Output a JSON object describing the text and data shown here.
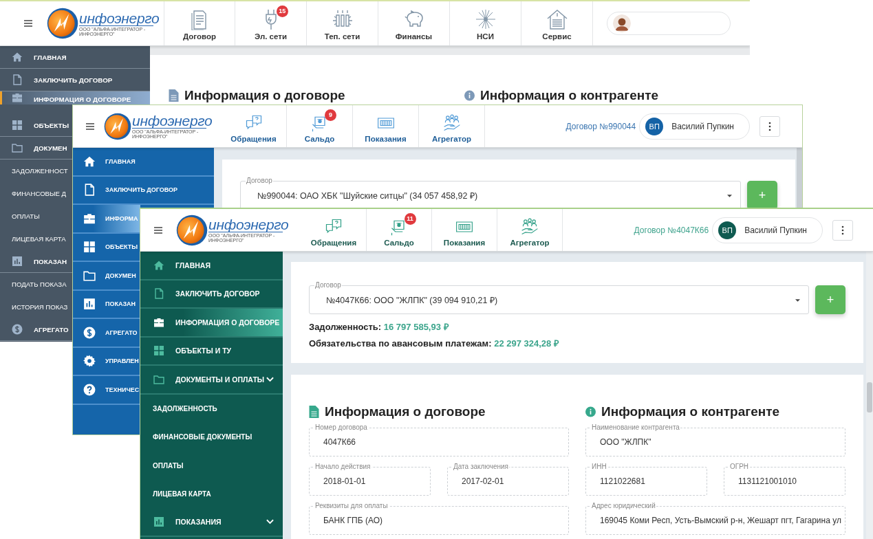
{
  "windows": [
    {
      "kind": "legacy",
      "brand": {
        "name": "инфоэнерго",
        "tagline": "ООО \"АЛЬФА-ИНТЕГРАТОР - ИНФОЭНЕРГО\""
      },
      "nav": [
        {
          "kind": "contract",
          "label": "Договор"
        },
        {
          "kind": "power",
          "label": "Эл. сети",
          "badge": "15"
        },
        {
          "kind": "heat",
          "label": "Теп. сети"
        },
        {
          "kind": "finance",
          "label": "Финансы"
        },
        {
          "kind": "nsi",
          "label": "НСИ"
        },
        {
          "kind": "service",
          "label": "Сервис"
        }
      ],
      "user": {
        "kind": "photo"
      },
      "sidebar": [
        {
          "kind": "home",
          "label": "ГЛАВНАЯ",
          "selected": false
        },
        {
          "kind": "file",
          "label": "ЗАКЛЮЧИТЬ ДОГОВОР",
          "selected": false
        },
        {
          "kind": "briefcase",
          "label": "ИНФОРМАЦИЯ О ДОГОВОРЕ",
          "selected": true
        },
        {
          "kind": "grid",
          "label": "ОБЪЕКТЫ",
          "selected": false
        },
        {
          "kind": "folder",
          "label": "ДОКУМЕН",
          "selected": false
        },
        {
          "kind": "sub",
          "label": "ЗАДОЛЖЕННОСТ",
          "selected": false
        },
        {
          "kind": "sub",
          "label": "ФИНАНСОВЫЕ Д",
          "selected": false
        },
        {
          "kind": "sub",
          "label": "ОПЛАТЫ",
          "selected": false
        },
        {
          "kind": "sub",
          "label": "ЛИЦЕВАЯ КАРТА",
          "selected": false
        },
        {
          "kind": "chart",
          "label": "ПОКАЗАН",
          "selected": false
        },
        {
          "kind": "sub",
          "label": "ПОДАТЬ ПОКАЗА",
          "selected": false
        },
        {
          "kind": "sub",
          "label": "ИСТОРИЯ ПОКАЗ",
          "selected": false
        },
        {
          "kind": "dollar",
          "label": "АГРЕГАТО",
          "selected": false
        }
      ],
      "headings": [
        {
          "kind": "doc",
          "text": "Информация о договоре"
        },
        {
          "kind": "info",
          "text": "Информация о контрагенте"
        }
      ]
    },
    {
      "kind": "blue",
      "brand": {
        "name": "инфоэнерго",
        "tagline": "ООО \"АЛЬФА-ИНТЕГРАТОР - ИНФОЭНЕРГО\""
      },
      "nav": [
        {
          "kind": "requests",
          "label": "Обращения"
        },
        {
          "kind": "balance",
          "label": "Сальдо",
          "badge": "9"
        },
        {
          "kind": "meters",
          "label": "Показания"
        },
        {
          "kind": "aggregator",
          "label": "Агрегатор"
        }
      ],
      "contract_link": "Договор №990044",
      "user": {
        "kind": "initials",
        "initials": "ВП",
        "name": "Василий Пупкин"
      },
      "sidebar": [
        {
          "kind": "home",
          "label": "ГЛАВНАЯ",
          "selected": false
        },
        {
          "kind": "file",
          "label": "ЗАКЛЮЧИТЬ ДОГОВОР",
          "selected": false
        },
        {
          "kind": "briefcase",
          "label": "ИНФОРМА",
          "selected": true
        },
        {
          "kind": "grid",
          "label": "ОБЪЕКТЫ",
          "selected": false
        },
        {
          "kind": "folder",
          "label": "ДОКУМЕН",
          "selected": false
        },
        {
          "kind": "chart",
          "label": "ПОКАЗАН",
          "selected": false
        },
        {
          "kind": "dollar",
          "label": "АГРЕГАТО",
          "selected": false
        },
        {
          "kind": "gear",
          "label": "УПРАВЛЕН",
          "selected": false
        },
        {
          "kind": "help",
          "label": "ТЕХНИЧЕС",
          "selected": false
        }
      ],
      "contract_select": {
        "label": "Договор",
        "value": "№990044: ОАО ХБК \"Шуйские ситцы\" (34 057 458,92 ₽)"
      },
      "add_button": "+"
    },
    {
      "kind": "teal",
      "brand": {
        "name": "инфоэнерго",
        "tagline": "ООО \"АЛЬФА-ИНТЕГРАТОР - ИНФОЭНЕРГО\""
      },
      "nav": [
        {
          "kind": "requests",
          "label": "Обращения"
        },
        {
          "kind": "balance",
          "label": "Сальдо",
          "badge": "11"
        },
        {
          "kind": "meters",
          "label": "Показания"
        },
        {
          "kind": "aggregator",
          "label": "Агрегатор"
        }
      ],
      "contract_link": "Договор №4047К66",
      "user": {
        "kind": "initials",
        "initials": "ВП",
        "name": "Василий Пупкин"
      },
      "sidebar": [
        {
          "kind": "home",
          "label": "ГЛАВНАЯ",
          "selected": false
        },
        {
          "kind": "file",
          "label": "ЗАКЛЮЧИТЬ ДОГОВОР",
          "selected": false
        },
        {
          "kind": "briefcase",
          "label": "ИНФОРМАЦИЯ О ДОГОВОРЕ",
          "selected": true
        },
        {
          "kind": "grid",
          "label": "ОБЪЕКТЫ И ТУ",
          "selected": false
        },
        {
          "kind": "folder",
          "label": "ДОКУМЕНТЫ И ОПЛАТЫ",
          "selected": false,
          "expanded": true
        },
        {
          "kind": "sub",
          "label": "ЗАДОЛЖЕННОСТЬ",
          "selected": false
        },
        {
          "kind": "sub",
          "label": "ФИНАНСОВЫЕ ДОКУМЕНТЫ",
          "selected": false
        },
        {
          "kind": "sub",
          "label": "ОПЛАТЫ",
          "selected": false
        },
        {
          "kind": "sub",
          "label": "ЛИЦЕВАЯ КАРТА",
          "selected": false
        },
        {
          "kind": "chart",
          "label": "ПОКАЗАНИЯ",
          "selected": false,
          "expanded": true
        }
      ],
      "contract_select": {
        "label": "Договор",
        "value": "№4047К66: ООО \"ЖЛПК\" (39 094 910,21 ₽)"
      },
      "add_button": "+",
      "summary": [
        {
          "label": "Задолженность:",
          "value": "16 797 585,93 ₽"
        },
        {
          "label": "Обязательства по авансовым платежам:",
          "value": "22 297 324,28 ₽"
        }
      ],
      "details": [
        {
          "heading": {
            "kind": "doc",
            "text": "Информация о договоре"
          },
          "rows": [
            [
              {
                "label": "Номер договора",
                "value": "4047К66"
              }
            ],
            [
              {
                "label": "Начало действия",
                "value": "2018-01-01"
              },
              {
                "label": "Дата заключения",
                "value": "2017-02-01"
              }
            ],
            [
              {
                "label": "Реквизиты для оплаты",
                "value": "БАНК ГПБ (АО)"
              }
            ]
          ]
        },
        {
          "heading": {
            "kind": "info",
            "text": "Информация о контрагенте"
          },
          "rows": [
            [
              {
                "label": "Наименование контрагента",
                "value": "ООО \"ЖЛПК\""
              }
            ],
            [
              {
                "label": "ИНН",
                "value": "1121022681"
              },
              {
                "label": "ОГРН",
                "value": "1131121001010"
              }
            ],
            [
              {
                "label": "Адрес юридический",
                "value": "169045 Коми Респ, Усть-Вымский р-н, Жешарт пгт, Гагарина ул"
              }
            ]
          ]
        }
      ]
    }
  ]
}
